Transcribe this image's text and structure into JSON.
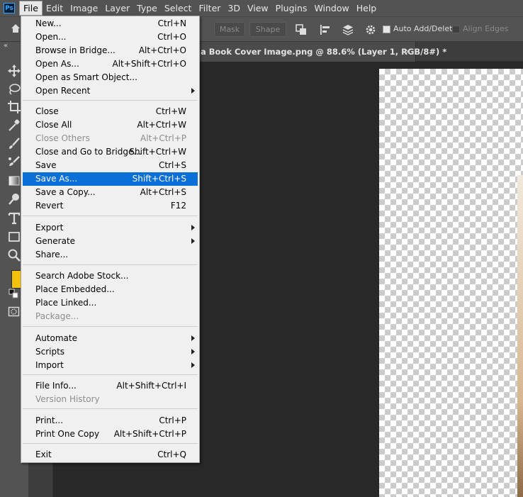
{
  "menubar": {
    "logo": "Ps",
    "items": [
      "File",
      "Edit",
      "Image",
      "Layer",
      "Type",
      "Select",
      "Filter",
      "3D",
      "View",
      "Plugins",
      "Window",
      "Help"
    ]
  },
  "options_bar": {
    "mask_label": "Mask",
    "shape_label": "Shape",
    "auto_add_delete": "Auto Add/Delete",
    "align_edges": "Align Edges"
  },
  "document": {
    "tab_title": "a Book Cover Image.png @ 88.6% (Layer 1, RGB/8#) *",
    "close_glyph": "×"
  },
  "toolbar": {
    "collapse_glyph": "«",
    "foreground_color": "#f6c10b"
  },
  "file_menu": {
    "items": [
      {
        "label": "New...",
        "shortcut": "Ctrl+N"
      },
      {
        "label": "Open...",
        "shortcut": "Ctrl+O"
      },
      {
        "label": "Browse in Bridge...",
        "shortcut": "Alt+Ctrl+O"
      },
      {
        "label": "Open As...",
        "shortcut": "Alt+Shift+Ctrl+O"
      },
      {
        "label": "Open as Smart Object...",
        "shortcut": ""
      },
      {
        "label": "Open Recent",
        "shortcut": ""
      },
      {
        "label": "Close",
        "shortcut": "Ctrl+W"
      },
      {
        "label": "Close All",
        "shortcut": "Alt+Ctrl+W"
      },
      {
        "label": "Close Others",
        "shortcut": "Alt+Ctrl+P"
      },
      {
        "label": "Close and Go to Bridge...",
        "shortcut": "Shift+Ctrl+W"
      },
      {
        "label": "Save",
        "shortcut": "Ctrl+S"
      },
      {
        "label": "Save As...",
        "shortcut": "Shift+Ctrl+S"
      },
      {
        "label": "Save a Copy...",
        "shortcut": "Alt+Ctrl+S"
      },
      {
        "label": "Revert",
        "shortcut": "F12"
      },
      {
        "label": "Export",
        "shortcut": ""
      },
      {
        "label": "Generate",
        "shortcut": ""
      },
      {
        "label": "Share...",
        "shortcut": ""
      },
      {
        "label": "Search Adobe Stock...",
        "shortcut": ""
      },
      {
        "label": "Place Embedded...",
        "shortcut": ""
      },
      {
        "label": "Place Linked...",
        "shortcut": ""
      },
      {
        "label": "Package...",
        "shortcut": ""
      },
      {
        "label": "Automate",
        "shortcut": ""
      },
      {
        "label": "Scripts",
        "shortcut": ""
      },
      {
        "label": "Import",
        "shortcut": ""
      },
      {
        "label": "File Info...",
        "shortcut": "Alt+Shift+Ctrl+I"
      },
      {
        "label": "Version History",
        "shortcut": ""
      },
      {
        "label": "Print...",
        "shortcut": "Ctrl+P"
      },
      {
        "label": "Print One Copy",
        "shortcut": "Alt+Shift+Ctrl+P"
      },
      {
        "label": "Exit",
        "shortcut": "Ctrl+Q"
      }
    ],
    "highlight_color": "#0a6fd6"
  }
}
